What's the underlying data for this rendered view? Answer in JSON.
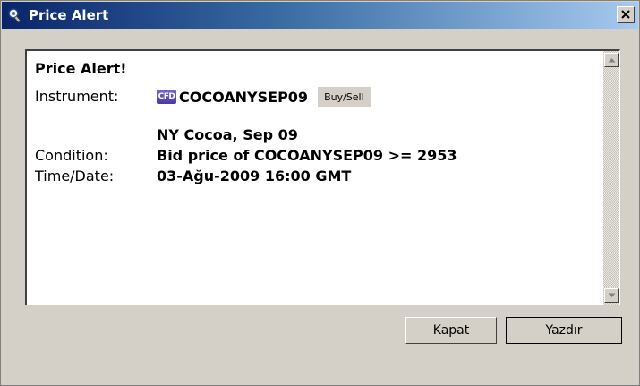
{
  "window": {
    "title": "Price Alert",
    "close_glyph": "✕"
  },
  "alert": {
    "heading": "Price Alert!",
    "instrument_label": "Instrument:",
    "instrument_badge": "CFD",
    "instrument_code": "COCOANYSEP09",
    "buysell_label": "Buy/Sell",
    "instrument_desc": "NY Cocoa, Sep 09",
    "condition_label": "Condition:",
    "condition_value": "Bid price of COCOANYSEP09 >= 2953",
    "time_label": "Time/Date:",
    "time_value": "03-Ağu-2009 16:00 GMT"
  },
  "buttons": {
    "close_label": "Kapat",
    "print_label": "Yazdır"
  },
  "icons": {
    "title": "alert-bell-icon",
    "badge": "cfd-icon"
  },
  "colors": {
    "titlebar_start": "#0a246a",
    "titlebar_end": "#a6caf0",
    "badge": "#5a48b0"
  }
}
